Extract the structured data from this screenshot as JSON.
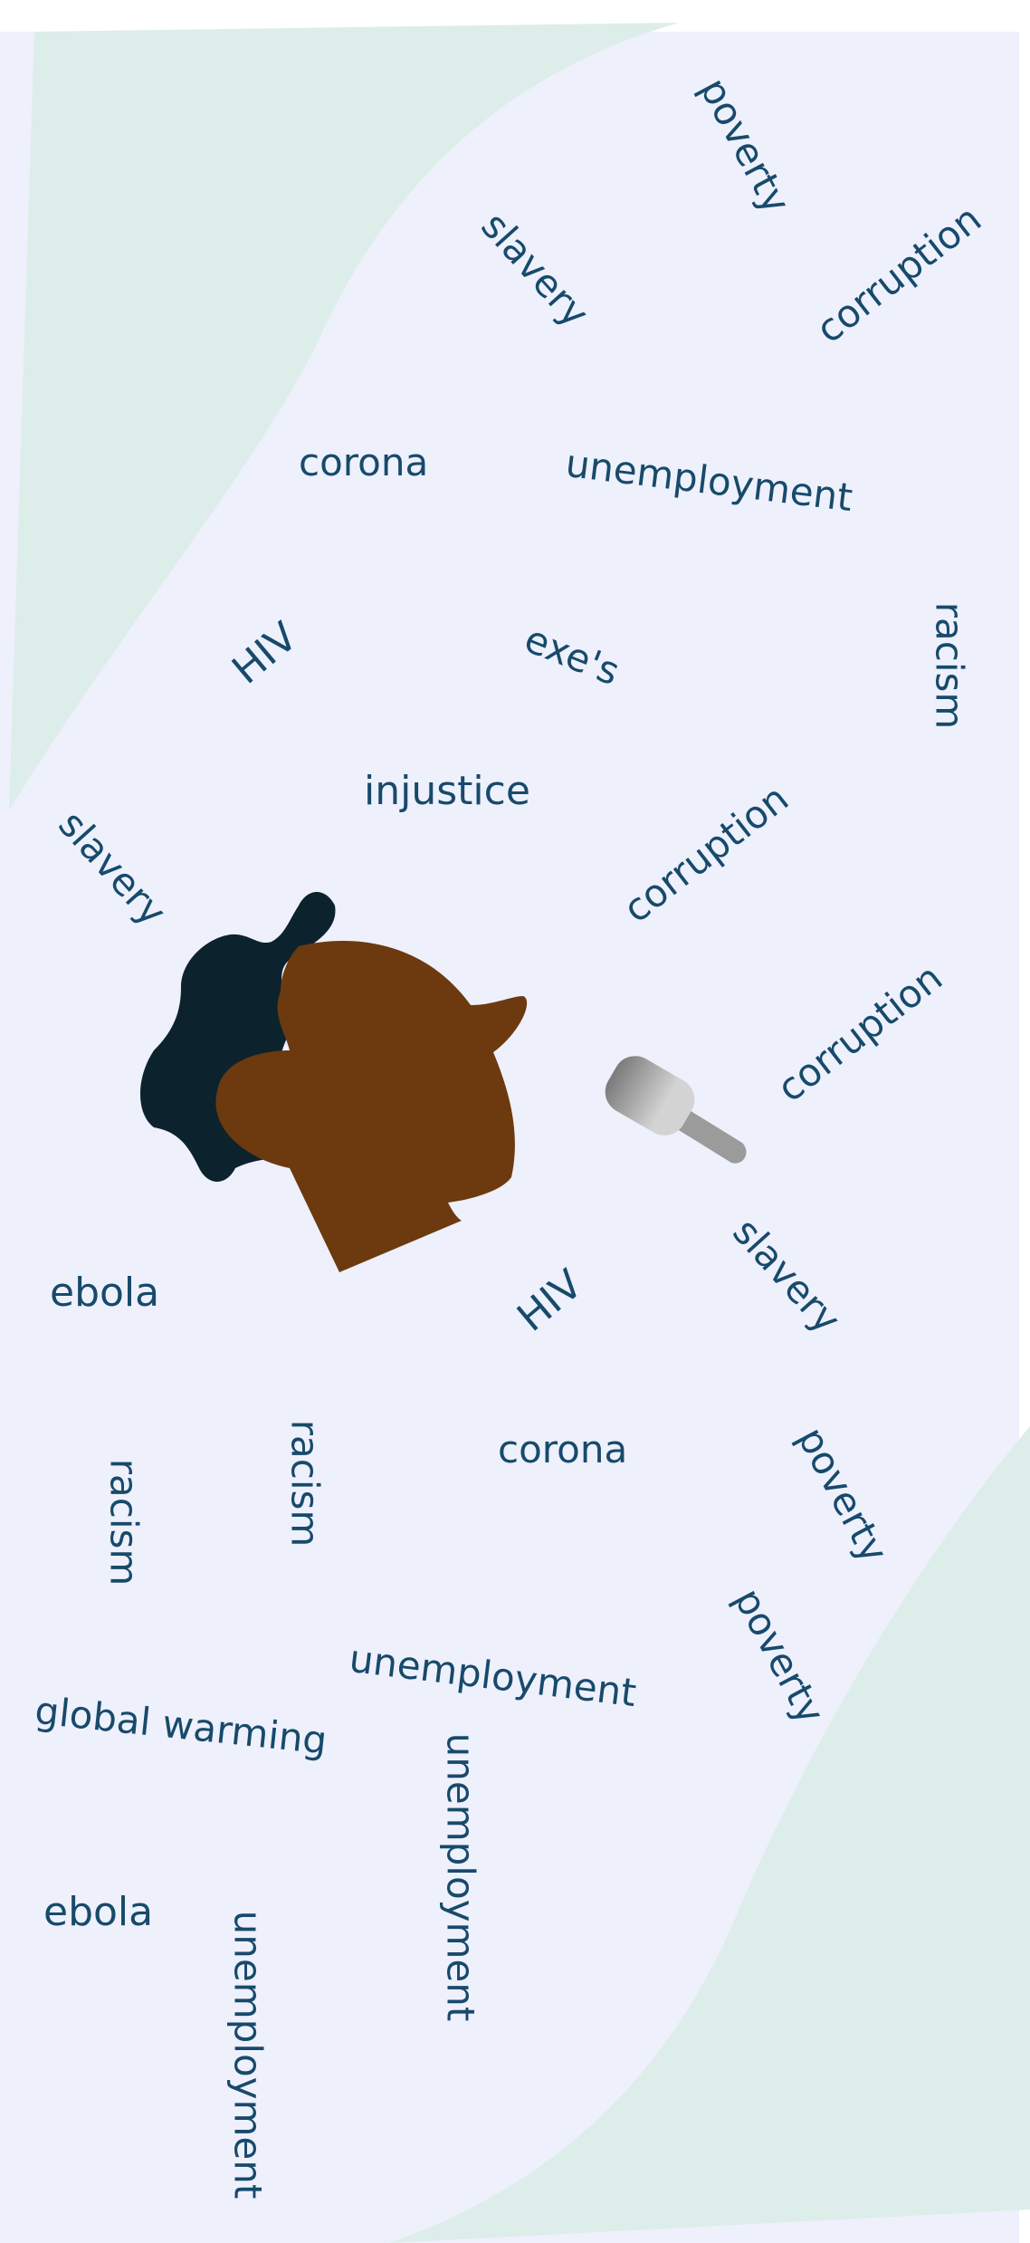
{
  "colors": {
    "page_background": "#ffffff",
    "canvas_background": "#eef0fb",
    "corner_shape": "#ddedea",
    "word_text": "#174a6b",
    "hair": "#0c232e",
    "skin": "#6c3a0e",
    "microphone_head_dark": "#7a7a7a",
    "microphone_head_light": "#d3d3d3",
    "microphone_handle": "#9b9b9b"
  },
  "words": [
    {
      "id": "poverty-top",
      "text": "poverty"
    },
    {
      "id": "slavery-top",
      "text": "slavery"
    },
    {
      "id": "corruption-top",
      "text": "corruption"
    },
    {
      "id": "corona-top",
      "text": "corona"
    },
    {
      "id": "unemployment-top",
      "text": "unemployment"
    },
    {
      "id": "hiv-top",
      "text": "HIV"
    },
    {
      "id": "exes",
      "text": "exe's"
    },
    {
      "id": "racism-top",
      "text": "racism"
    },
    {
      "id": "injustice",
      "text": "injustice"
    },
    {
      "id": "slavery-left",
      "text": "slavery"
    },
    {
      "id": "corruption-mid",
      "text": "corruption"
    },
    {
      "id": "corruption-right",
      "text": "corruption"
    },
    {
      "id": "ebola-top",
      "text": "ebola"
    },
    {
      "id": "hiv-bottom",
      "text": "HIV"
    },
    {
      "id": "slavery-bottom",
      "text": "slavery"
    },
    {
      "id": "corona-bottom",
      "text": "corona"
    },
    {
      "id": "racism-left",
      "text": "racism"
    },
    {
      "id": "racism-mid",
      "text": "racism"
    },
    {
      "id": "poverty-mid",
      "text": "poverty"
    },
    {
      "id": "poverty-low",
      "text": "poverty"
    },
    {
      "id": "unemployment-mid",
      "text": "unemployment"
    },
    {
      "id": "global-warming",
      "text": "global warming"
    },
    {
      "id": "unemployment-vertical-right",
      "text": "unemployment"
    },
    {
      "id": "ebola-bottom",
      "text": "ebola"
    },
    {
      "id": "unemployment-vertical-left",
      "text": "unemployment"
    }
  ],
  "figure": {
    "head_icon": "afro-head-profile-icon",
    "microphone_icon": "microphone-icon"
  }
}
